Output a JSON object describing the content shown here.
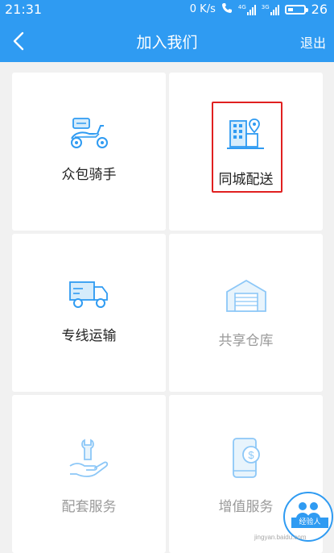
{
  "status": {
    "time": "21:31",
    "network_speed": "0 K/s",
    "sim1": "4G",
    "sim2": "3G",
    "battery": "26"
  },
  "navbar": {
    "title": "加入我们",
    "logout_label": "退出"
  },
  "cards": [
    {
      "label": "众包骑手",
      "icon": "scooter-icon",
      "enabled": true
    },
    {
      "label": "同城配送",
      "icon": "city-building-icon",
      "enabled": true,
      "highlighted": true
    },
    {
      "label": "专线运输",
      "icon": "truck-icon",
      "enabled": true
    },
    {
      "label": "共享仓库",
      "icon": "warehouse-icon",
      "enabled": false
    },
    {
      "label": "配套服务",
      "icon": "wrench-hand-icon",
      "enabled": false
    },
    {
      "label": "增值服务",
      "icon": "phone-dollar-icon",
      "enabled": false
    }
  ],
  "watermark": {
    "badge_text": "经验人",
    "site_text": "jingyan.baidu.com"
  },
  "colors": {
    "primary": "#2f9bf2",
    "highlight_border": "#e02020",
    "background": "#f1f1f1"
  }
}
